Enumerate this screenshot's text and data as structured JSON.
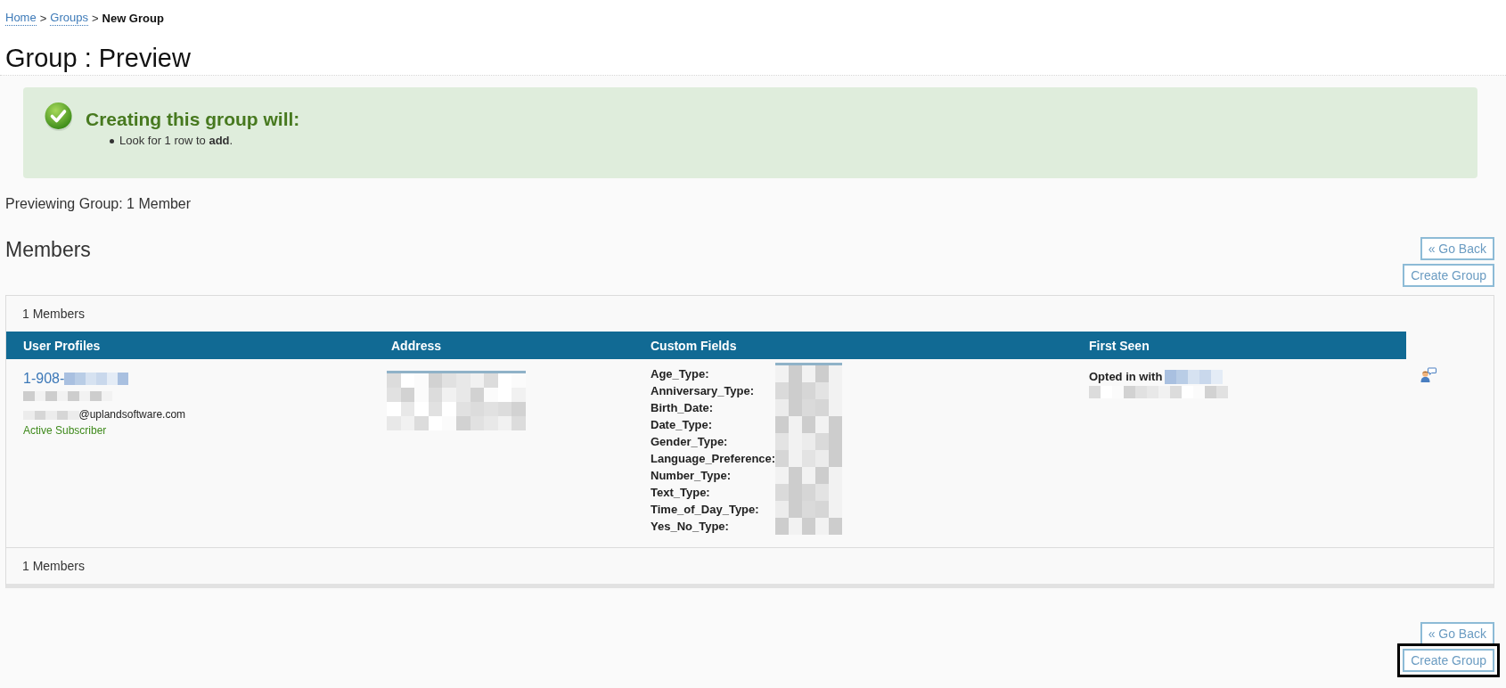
{
  "breadcrumb": [
    {
      "label": "Home",
      "kind": "link"
    },
    {
      "label": ">",
      "kind": "separator"
    },
    {
      "label": "Groups",
      "kind": "link"
    },
    {
      "label": ">",
      "kind": "separator"
    },
    {
      "label": "New Group",
      "kind": "current"
    }
  ],
  "page_title": "Group : Preview",
  "notice": {
    "title": "Creating this group will:",
    "items": [
      "Look for 1 row to **add**."
    ]
  },
  "preview_summary": "Previewing Group: 1 Member",
  "members": {
    "title": "Members",
    "actions_top": [
      {
        "label": "« Go Back",
        "focused": false
      },
      {
        "label": "Create Group",
        "focused": false
      }
    ],
    "table": {
      "count_top": "1 Members",
      "columns": [
        "User Profiles",
        "Address",
        "Custom Fields",
        "First Seen"
      ],
      "rows": [
        {
          "phone": "1-908-",
          "email_domain": "@uplandsoftware.com",
          "status": "Active Subscriber",
          "custom_fields": [
            "Age_Type:",
            "Anniversary_Type:",
            "Birth_Date:",
            "Date_Type:",
            "Gender_Type:",
            "Language_Preference:",
            "Number_Type:",
            "Text_Type:",
            "Time_of_Day_Type:",
            "Yes_No_Type:"
          ],
          "first_seen": "Opted in with"
        }
      ],
      "count_bottom": "1 Members"
    },
    "actions_bottom": [
      {
        "label": "« Go Back",
        "focused": false
      },
      {
        "label": "Create Group",
        "focused": true
      }
    ]
  }
}
